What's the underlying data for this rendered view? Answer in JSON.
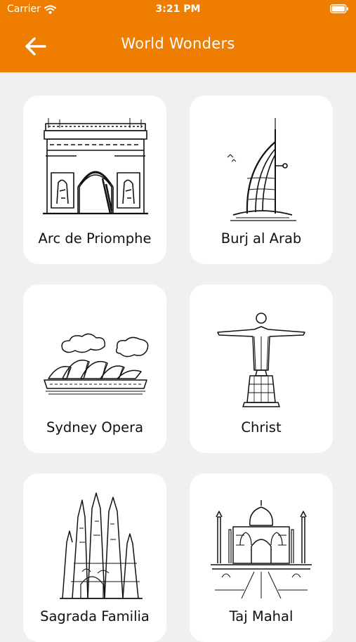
{
  "status_bar": {
    "carrier": "Carrier",
    "time": "3:21 PM",
    "wifi_icon": "wifi-icon",
    "battery_icon": "battery-icon"
  },
  "nav": {
    "title": "World Wonders",
    "back_icon": "back-arrow-icon"
  },
  "colors": {
    "header_bg": "#ee7d00",
    "page_bg": "#f0f0f0",
    "card_bg": "#ffffff"
  },
  "wonders": [
    {
      "label": "Arc de Priomphe",
      "icon": "arc-de-triomphe-sketch"
    },
    {
      "label": "Burj al Arab",
      "icon": "burj-al-arab-sketch"
    },
    {
      "label": "Sydney Opera",
      "icon": "sydney-opera-sketch"
    },
    {
      "label": "Christ",
      "icon": "christ-the-redeemer-sketch"
    },
    {
      "label": "Sagrada Familia",
      "icon": "sagrada-familia-sketch"
    },
    {
      "label": "Taj Mahal",
      "icon": "taj-mahal-sketch"
    }
  ]
}
